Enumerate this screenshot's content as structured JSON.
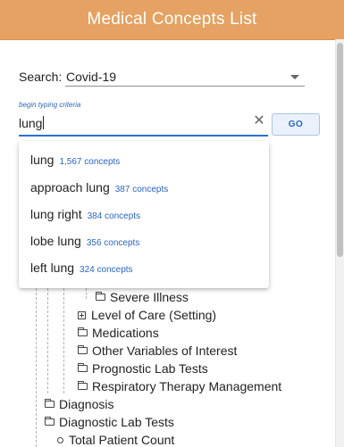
{
  "header": {
    "title": "Medical Concepts List",
    "background": "#e5a262"
  },
  "search": {
    "label": "Search:",
    "selected": "Covid-19"
  },
  "criteria": {
    "hint": "begin typing criteria",
    "value": "lung",
    "go_label": "GO"
  },
  "suggestions": [
    {
      "term": "lung",
      "count": "1,567 concepts"
    },
    {
      "term": "approach lung",
      "count": "387 concepts"
    },
    {
      "term": "lung right",
      "count": "384 concepts"
    },
    {
      "term": "lobe lung",
      "count": "356 concepts"
    },
    {
      "term": "left lung",
      "count": "324 concepts"
    }
  ],
  "tree": {
    "severe_illness": "Severe Illness",
    "level_of_care": "Level of Care (Setting)",
    "medications": "Medications",
    "other_variables": "Other Variables of Interest",
    "prognostic_lab_tests": "Prognostic Lab Tests",
    "respiratory_therapy": "Respiratory Therapy Management",
    "diagnosis": "Diagnosis",
    "diagnostic_lab_tests": "Diagnostic Lab Tests",
    "total_patient_count": "Total Patient Count"
  },
  "icons": [
    "folder-icon",
    "expand-plus-icon",
    "circle-icon",
    "clear-icon",
    "chevron-down-icon"
  ],
  "colors": {
    "accent": "#2b66c2",
    "input_focus": "#2a6fd6"
  }
}
